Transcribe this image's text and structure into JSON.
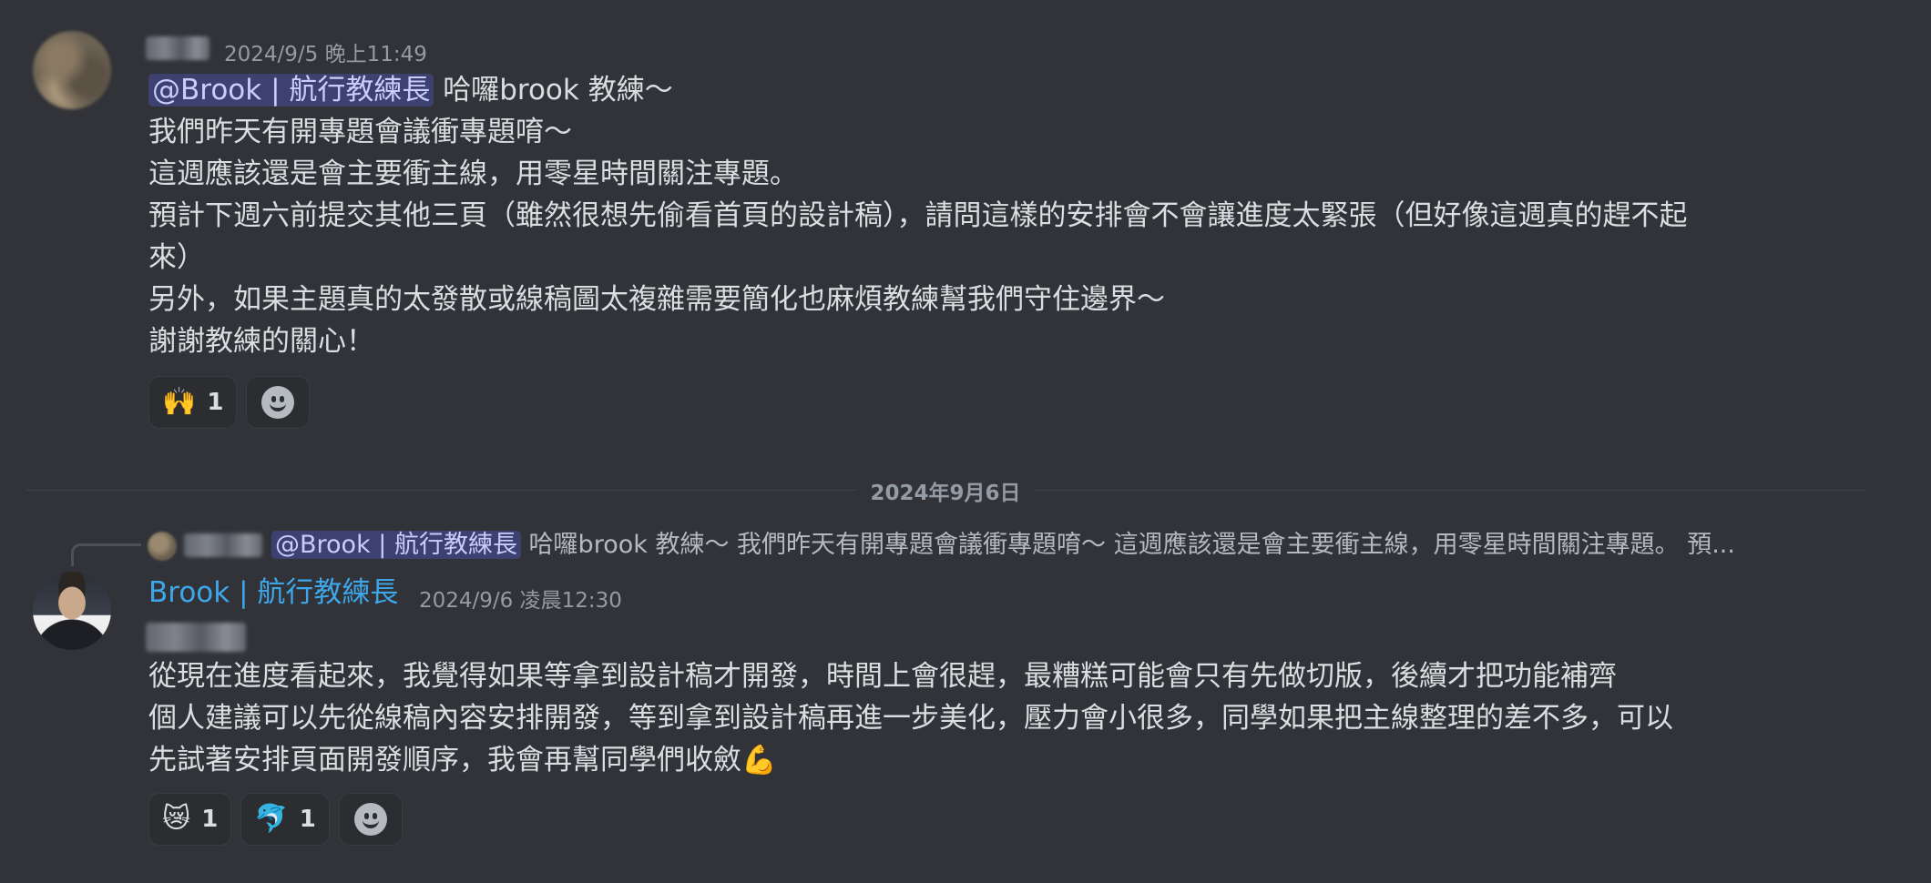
{
  "message1": {
    "timestamp": "2024/9/5 晚上11:49",
    "mention": "@Brook | 航行教練長",
    "first_line_rest": " 哈囉brook 教練～",
    "lines": [
      "我們昨天有開專題會議衝專題唷～",
      "這週應該還是會主要衝主線，用零星時間關注專題。",
      "預計下週六前提交其他三頁（雖然很想先偷看首頁的設計稿），請問這樣的安排會不會讓進度太緊張（但好像這週真的趕不起",
      "來）",
      "另外，如果主題真的太發散或線稿圖太複雜需要簡化也麻煩教練幫我們守住邊界～",
      "謝謝教練的關心！"
    ],
    "reactions": [
      {
        "emoji": "🙌",
        "count": "1"
      }
    ]
  },
  "divider": {
    "date": "2024年9月6日"
  },
  "reply_preview": {
    "mention": "@Brook | 航行教練長",
    "text": " 哈囉brook 教練～ 我們昨天有開專題會議衝專題唷～ 這週應該還是會主要衝主線，用零星時間關注專題。 預..."
  },
  "message2": {
    "author": "Brook | 航行教練長",
    "timestamp": "2024/9/6 凌晨12:30",
    "lines": [
      "從現在進度看起來，我覺得如果等拿到設計稿才開發，時間上會很趕，最糟糕可能會只有先做切版，後續才把功能補齊",
      "個人建議可以先從線稿內容安排開發，等到拿到設計稿再進一步美化，壓力會小很多，同學如果把主線整理的差不多，可以",
      "先試著安排頁面開發順序，我會再幫同學們收斂💪"
    ],
    "reactions": [
      {
        "emoji": "😿",
        "count": "1"
      },
      {
        "emoji": "🐬",
        "count": "1"
      }
    ]
  },
  "icons": {
    "add_reaction": "add-reaction-smiley-icon"
  }
}
